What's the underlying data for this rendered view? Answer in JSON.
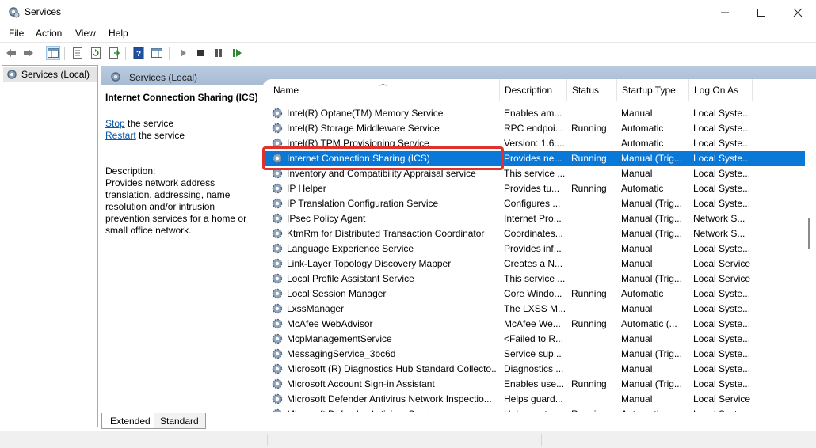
{
  "window": {
    "title": "Services",
    "app_icon": "gears-icon"
  },
  "menubar": {
    "items": [
      "File",
      "Action",
      "View",
      "Help"
    ]
  },
  "toolbar": {
    "buttons": [
      "back-arrow-icon",
      "forward-arrow-icon",
      "show-hide-console-tree-icon",
      "properties-icon",
      "refresh-icon",
      "export-list-icon",
      "help-icon",
      "show-hide-action-pane-icon",
      "start-service-icon",
      "stop-service-icon",
      "pause-service-icon",
      "restart-service-icon"
    ]
  },
  "tree": {
    "root_label": "Services (Local)"
  },
  "panel": {
    "header": "Services (Local)"
  },
  "details": {
    "service_name": "Internet Connection Sharing (ICS)",
    "stop_link": "Stop",
    "stop_suffix": " the service",
    "restart_link": "Restart",
    "restart_suffix": " the service",
    "description_label": "Description:",
    "description": "Provides network address translation, addressing, name resolution and/or intrusion prevention services for a home or small office network."
  },
  "table": {
    "columns": [
      "Name",
      "Description",
      "Status",
      "Startup Type",
      "Log On As"
    ],
    "rows": [
      [
        "Intel(R) Optane(TM) Memory Service",
        "Enables am...",
        "",
        "Manual",
        "Local Syste..."
      ],
      [
        "Intel(R) Storage Middleware Service",
        "RPC endpoi...",
        "Running",
        "Automatic",
        "Local Syste..."
      ],
      [
        "Intel(R) TPM Provisioning Service",
        "Version: 1.6....",
        "",
        "Automatic",
        "Local Syste..."
      ],
      [
        "Internet Connection Sharing (ICS)",
        "Provides ne...",
        "Running",
        "Manual (Trig...",
        "Local Syste..."
      ],
      [
        "Inventory and Compatibility Appraisal service",
        "This service ...",
        "",
        "Manual",
        "Local Syste..."
      ],
      [
        "IP Helper",
        "Provides tu...",
        "Running",
        "Automatic",
        "Local Syste..."
      ],
      [
        "IP Translation Configuration Service",
        "Configures ...",
        "",
        "Manual (Trig...",
        "Local Syste..."
      ],
      [
        "IPsec Policy Agent",
        "Internet Pro...",
        "",
        "Manual (Trig...",
        "Network S..."
      ],
      [
        "KtmRm for Distributed Transaction Coordinator",
        "Coordinates...",
        "",
        "Manual (Trig...",
        "Network S..."
      ],
      [
        "Language Experience Service",
        "Provides inf...",
        "",
        "Manual",
        "Local Syste..."
      ],
      [
        "Link-Layer Topology Discovery Mapper",
        "Creates a N...",
        "",
        "Manual",
        "Local Service"
      ],
      [
        "Local Profile Assistant Service",
        "This service ...",
        "",
        "Manual (Trig...",
        "Local Service"
      ],
      [
        "Local Session Manager",
        "Core Windo...",
        "Running",
        "Automatic",
        "Local Syste..."
      ],
      [
        "LxssManager",
        "The LXSS M...",
        "",
        "Manual",
        "Local Syste..."
      ],
      [
        "McAfee WebAdvisor",
        "McAfee We...",
        "Running",
        "Automatic (...",
        "Local Syste..."
      ],
      [
        "McpManagementService",
        "<Failed to R...",
        "",
        "Manual",
        "Local Syste..."
      ],
      [
        "MessagingService_3bc6d",
        "Service sup...",
        "",
        "Manual (Trig...",
        "Local Syste..."
      ],
      [
        "Microsoft (R) Diagnostics Hub Standard Collecto...",
        "Diagnostics ...",
        "",
        "Manual",
        "Local Syste..."
      ],
      [
        "Microsoft Account Sign-in Assistant",
        "Enables use...",
        "Running",
        "Manual (Trig...",
        "Local Syste..."
      ],
      [
        "Microsoft Defender Antivirus Network Inspectio...",
        "Helps guard...",
        "",
        "Manual",
        "Local Service"
      ],
      [
        "Microsoft Defender Antivirus Service",
        "Helps prot...",
        "Running",
        "Automatic",
        "Local Syste..."
      ]
    ],
    "selected_index": 3
  },
  "tabs": {
    "extended": "Extended",
    "standard": "Standard"
  },
  "colors": {
    "selection": "#0a78d7",
    "highlight": "#e0322d",
    "panel_header": "#b8cbe0",
    "link": "#0a58a8"
  }
}
